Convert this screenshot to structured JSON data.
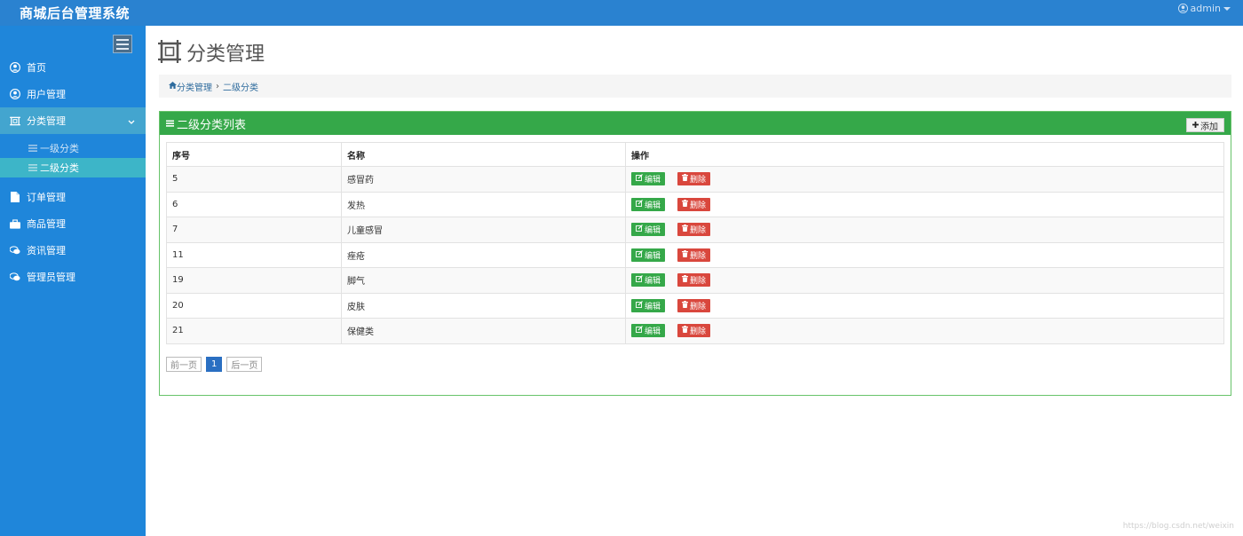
{
  "header": {
    "brand": "商城后台管理系统",
    "user": "admin"
  },
  "sidebar": {
    "items": [
      {
        "label": "首页",
        "icon": "user-circle-icon"
      },
      {
        "label": "用户管理",
        "icon": "user-circle-icon"
      },
      {
        "label": "分类管理",
        "icon": "crop-icon",
        "active": true,
        "expanded": true
      },
      {
        "label": "订单管理",
        "icon": "file-icon"
      },
      {
        "label": "商品管理",
        "icon": "briefcase-icon"
      },
      {
        "label": "资讯管理",
        "icon": "comments-icon"
      },
      {
        "label": "管理员管理",
        "icon": "comments-icon"
      }
    ],
    "subitems": [
      {
        "label": "一级分类",
        "icon": "list-icon"
      },
      {
        "label": "二级分类",
        "icon": "list-icon",
        "active": true
      }
    ]
  },
  "main": {
    "page_title": "分类管理",
    "breadcrumb": {
      "root": "分类管理",
      "current": "二级分类"
    },
    "panel": {
      "title": "二级分类列表",
      "add_label": "添加"
    },
    "table": {
      "headers": [
        "序号",
        "名称",
        "操作"
      ],
      "rows": [
        {
          "id": "5",
          "name": "感冒药"
        },
        {
          "id": "6",
          "name": "发热"
        },
        {
          "id": "7",
          "name": "儿童感冒"
        },
        {
          "id": "11",
          "name": "痤疮"
        },
        {
          "id": "19",
          "name": "脚气"
        },
        {
          "id": "20",
          "name": "皮肤"
        },
        {
          "id": "21",
          "name": "保健类"
        }
      ],
      "edit_label": "编辑",
      "delete_label": "删除"
    },
    "pager": {
      "prev": "前一页",
      "current": "1",
      "next": "后一页"
    }
  },
  "watermark": "https://blog.csdn.net/weixin",
  "colors": {
    "topbar": "#2a82d0",
    "sidebar": "#1f86da",
    "panel_green": "#35a849",
    "delete_red": "#d9473d",
    "active_sub": "#3db5c8"
  }
}
